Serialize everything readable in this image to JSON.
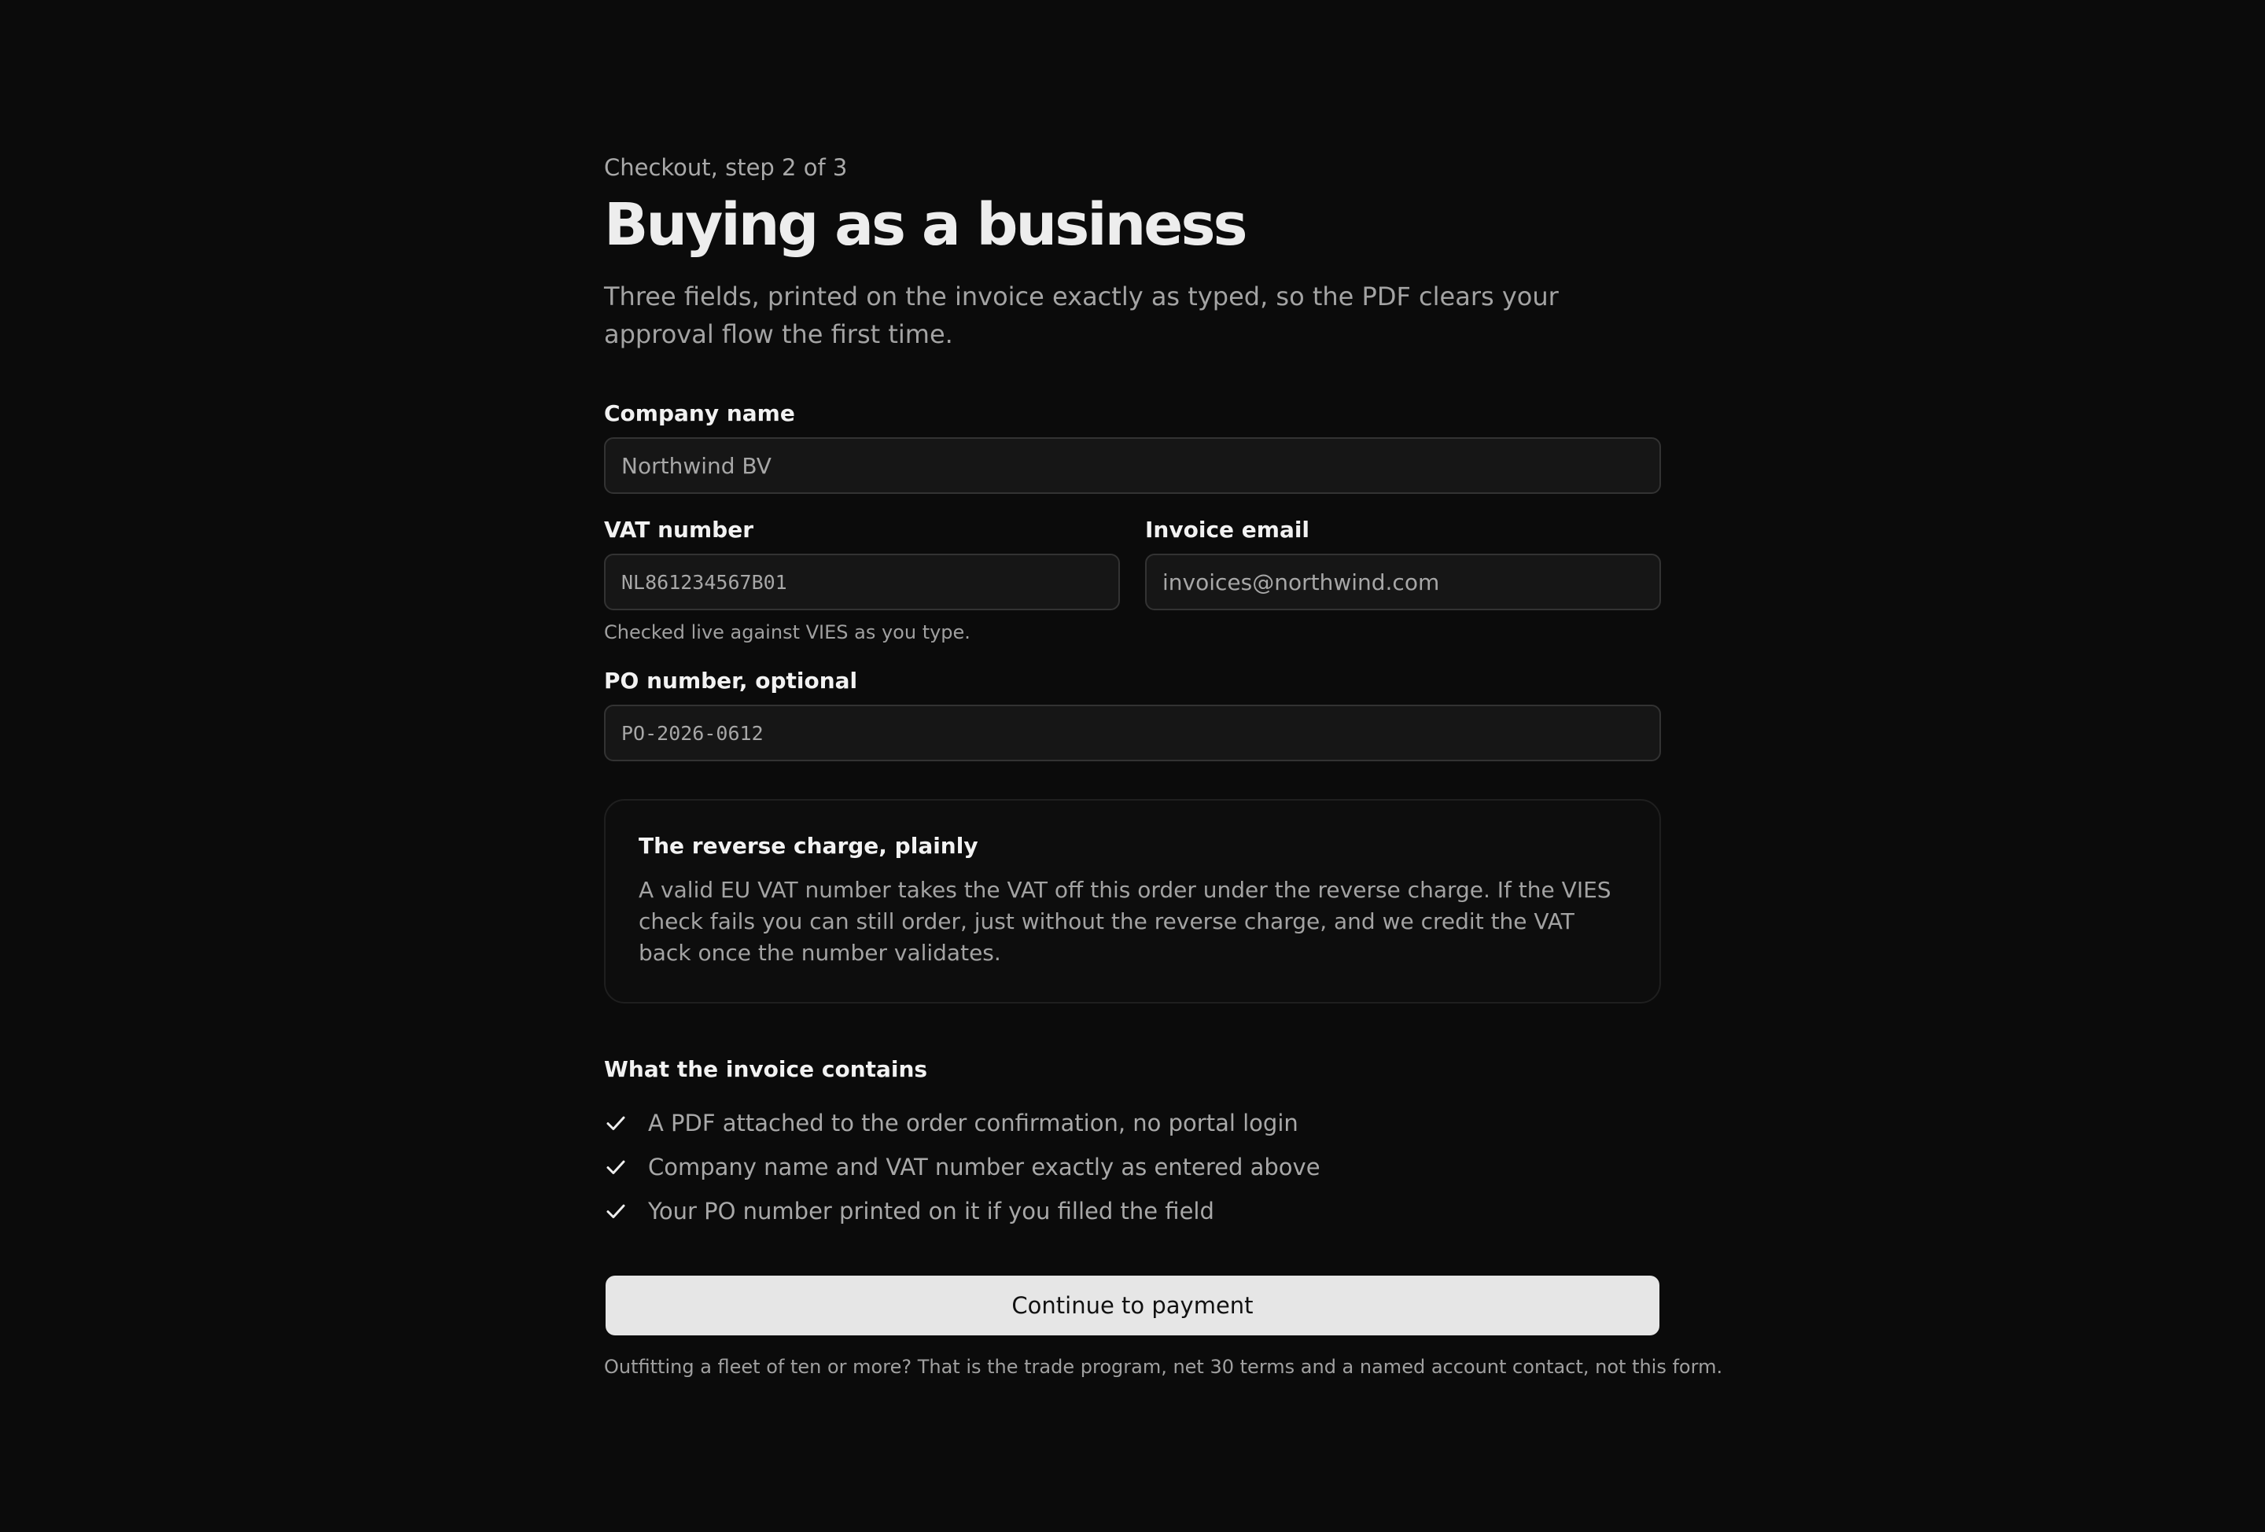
{
  "header": {
    "step": "Checkout, step 2 of 3",
    "title": "Buying as a business",
    "lede": "Three fields, printed on the invoice exactly as typed, so the PDF clears your approval flow the first time."
  },
  "form": {
    "company_name": {
      "label": "Company name",
      "value": "Northwind BV"
    },
    "vat_number": {
      "label": "VAT number",
      "value": "NL861234567B01",
      "hint": "Checked live against VIES as you type."
    },
    "invoice_email": {
      "label": "Invoice email",
      "value": "invoices@northwind.com"
    },
    "po_number": {
      "label": "PO number, optional",
      "value": "PO-2026-0612"
    }
  },
  "callout": {
    "title": "The reverse charge, plainly",
    "body": "A valid EU VAT number takes the VAT off this order under the reverse charge. If the VIES check fails you can still order, just without the reverse charge, and we credit the VAT back once the number validates."
  },
  "invoice_contents": {
    "title": "What the invoice contains",
    "icon": "check-icon",
    "items": [
      "A PDF attached to the order confirmation, no portal login",
      "Company name and VAT number exactly as entered above",
      "Your PO number printed on it if you filled the field"
    ]
  },
  "actions": {
    "continue_label": "Continue to payment"
  },
  "footnote": "Outfitting a fleet of ten or more? That is the trade program, net 30 terms and a named account contact, not this form.",
  "colors": {
    "background": "#0b0b0b",
    "input_background": "#161616",
    "input_border": "#333333",
    "button_background": "#e6e6e6",
    "muted_text": "#a3a3a3"
  }
}
